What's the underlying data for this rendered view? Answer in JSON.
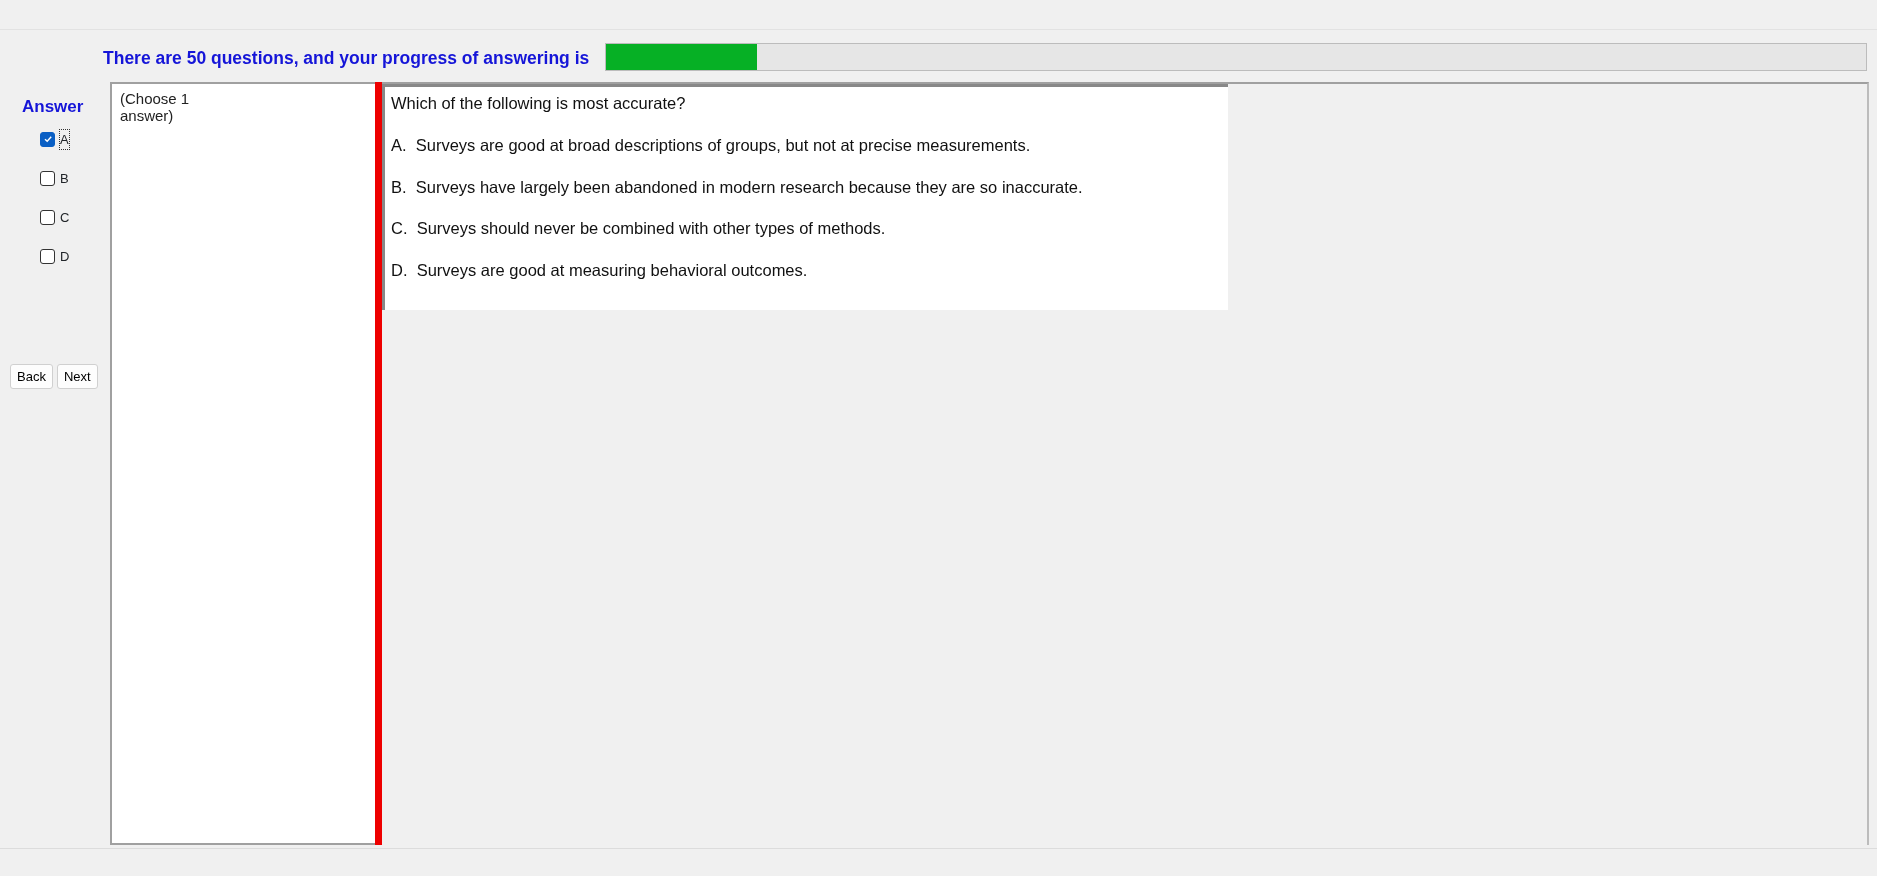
{
  "progress": {
    "label": "There are 50 questions, and your progress of answering is",
    "level": 0.12
  },
  "answer": {
    "title": "Answer",
    "options": [
      {
        "label": "A",
        "checked": true,
        "focused": true
      },
      {
        "label": "B",
        "checked": false,
        "focused": false
      },
      {
        "label": "C",
        "checked": false,
        "focused": false
      },
      {
        "label": "D",
        "checked": false,
        "focused": false
      }
    ]
  },
  "buttons": [
    "Back",
    "Next"
  ],
  "note": "(Choose 1\nanswer)",
  "question": {
    "text": "Which of the following is most accurate?",
    "choices": [
      "A.  Surveys are good at broad descriptions of groups, but not at precise measurements.",
      "B.  Surveys have largely been abandoned in modern research because they are so inaccurate.",
      "C.  Surveys should never be combined with other types of methods.",
      "D.  Surveys are good at measuring behavioral outcomes."
    ]
  }
}
